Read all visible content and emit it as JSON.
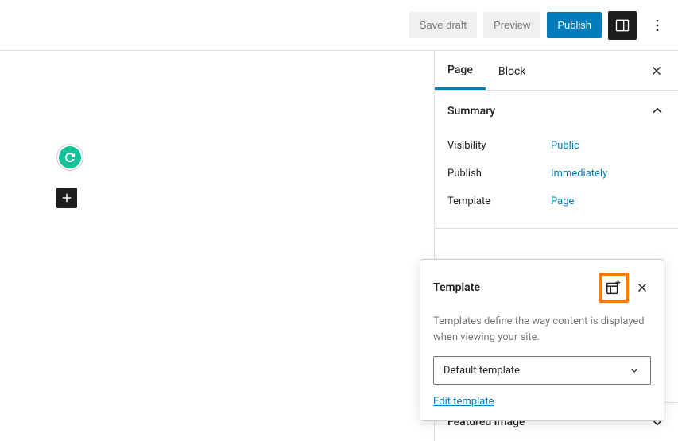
{
  "topbar": {
    "save_draft": "Save draft",
    "preview": "Preview",
    "publish": "Publish"
  },
  "sidebar": {
    "tabs": {
      "page": "Page",
      "block": "Block"
    },
    "summary": {
      "title": "Summary",
      "rows": {
        "visibility": {
          "label": "Visibility",
          "value": "Public"
        },
        "publish": {
          "label": "Publish",
          "value": "Immediately"
        },
        "template": {
          "label": "Template",
          "value": "Page"
        }
      }
    },
    "featured_image": "Featured image"
  },
  "popover": {
    "title": "Template",
    "description": "Templates define the way content is displayed when viewing your site.",
    "select_value": "Default template",
    "edit_link": "Edit template"
  }
}
